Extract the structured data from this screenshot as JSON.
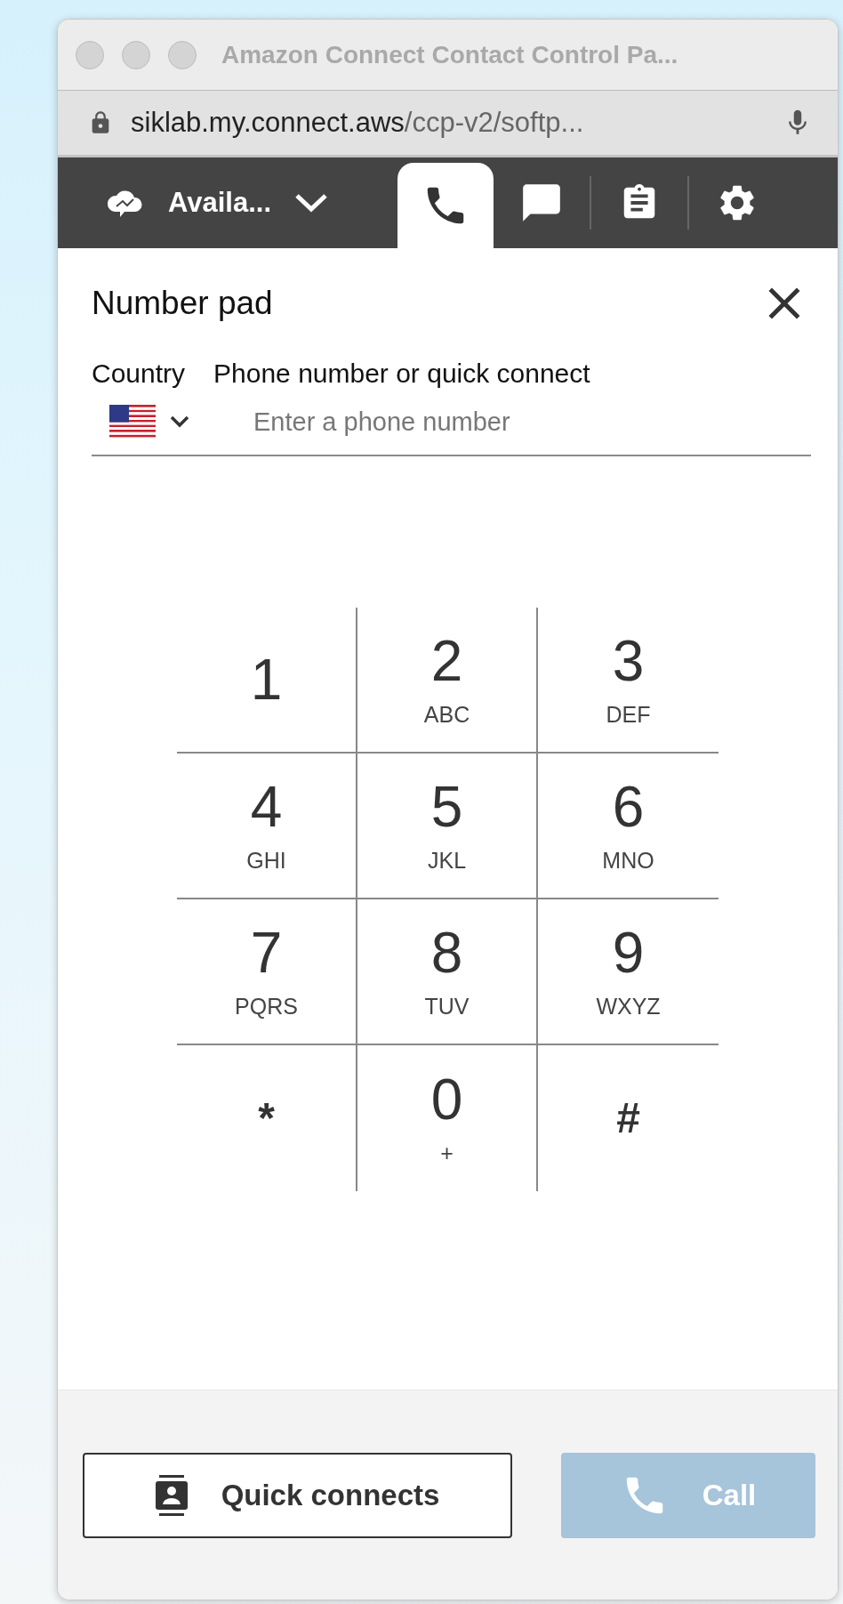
{
  "window": {
    "title": "Amazon Connect Contact Control Pa..."
  },
  "address_bar": {
    "host": "siklab.my.connect.aws",
    "path": "/ccp-v2/softp..."
  },
  "toolbar": {
    "status": "Availa...",
    "tabs": [
      {
        "kind": "phone",
        "selected": true
      },
      {
        "kind": "chat",
        "selected": false
      },
      {
        "kind": "task",
        "selected": false
      },
      {
        "kind": "settings",
        "selected": false
      }
    ]
  },
  "panel": {
    "title": "Number pad",
    "country_label": "Country",
    "phone_label": "Phone number or quick connect",
    "placeholder": "Enter a phone number"
  },
  "keypad": [
    {
      "digit": "1"
    },
    {
      "digit": "2",
      "letters": "ABC"
    },
    {
      "digit": "3",
      "letters": "DEF"
    },
    {
      "digit": "4",
      "letters": "GHI"
    },
    {
      "digit": "5",
      "letters": "JKL"
    },
    {
      "digit": "6",
      "letters": "MNO"
    },
    {
      "digit": "7",
      "letters": "PQRS"
    },
    {
      "digit": "8",
      "letters": "TUV"
    },
    {
      "digit": "9",
      "letters": "WXYZ"
    },
    {
      "digit": "*",
      "kind": "symbol"
    },
    {
      "digit": "0",
      "letters": "+"
    },
    {
      "digit": "#",
      "kind": "symbol"
    }
  ],
  "footer": {
    "quick_connects": {
      "label": "Quick connects"
    },
    "call": {
      "label": "Call",
      "disabled": true
    }
  }
}
